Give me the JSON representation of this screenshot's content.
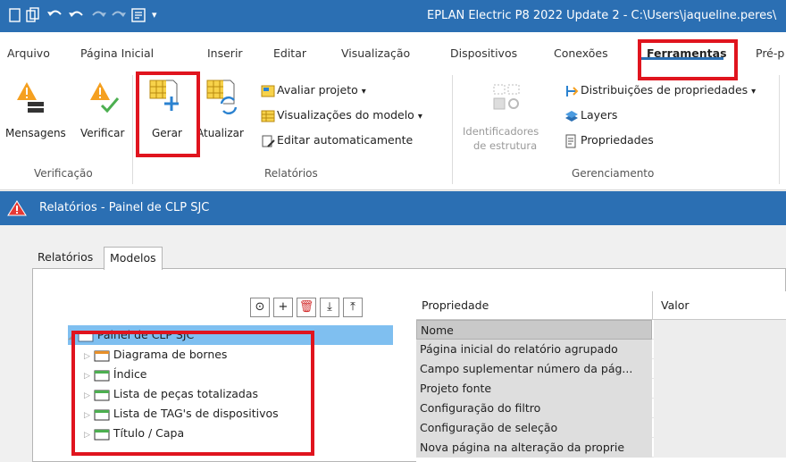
{
  "window": {
    "title": "EPLAN Electric P8 2022 Update 2 - C:\\Users\\jaqueline.peres\\",
    "quick_access_icons": [
      "new-page-icon",
      "copy-page-icon",
      "undo-icon",
      "undo-arrow-icon",
      "redo-icon",
      "redo-arrow-icon",
      "quick-access-menu-icon"
    ],
    "quick_access_chevron": "▾"
  },
  "ribbon_tabs": [
    "Arquivo",
    "Página Inicial",
    "Inserir",
    "Editar",
    "Visualização",
    "Dispositivos",
    "Conexões",
    "Ferramentas",
    "Pré-p"
  ],
  "active_tab": "Ferramentas",
  "groups": {
    "verificacao": {
      "label": "Verificação",
      "mensagens": "Mensagens",
      "verificar": "Verificar"
    },
    "relatorios": {
      "label": "Relatórios",
      "gerar": "Gerar",
      "atualizar": "Atualizar",
      "avaliar_projeto": "Avaliar projeto",
      "visualizacoes_modelo": "Visualizações do modelo",
      "editar_automaticamente": "Editar automaticamente",
      "dropdown_glyph": "▾"
    },
    "gerenciamento": {
      "label": "Gerenciamento",
      "identificadores_line1": "Identificadores",
      "identificadores_line2": "de estrutura",
      "distribuicoes": "Distribuições de propriedades",
      "layers": "Layers",
      "propriedades": "Propriedades",
      "dropdown_glyph": "▾"
    }
  },
  "panel": {
    "title": "Relatórios - Painel de CLP SJC",
    "tabs": [
      "Relatórios",
      "Modelos"
    ],
    "selected_tab": "Modelos"
  },
  "tree_toolbar": {
    "glyphs": [
      "⊙",
      "+",
      "🗑",
      "⤓",
      "⤒"
    ]
  },
  "tree": {
    "root": "Painel de CLP SJC",
    "children": [
      "Diagrama de bornes",
      "Índice",
      "Lista de peças totalizadas",
      "Lista de TAG's de dispositivos",
      "Título / Capa"
    ]
  },
  "property_grid": {
    "columns": [
      "Propriedade",
      "Valor"
    ],
    "rows": [
      "Nome",
      "Página inicial do relatório agrupado",
      "Campo suplementar número da pág...",
      "Projeto fonte",
      "Configuração do filtro",
      "Configuração de seleção",
      "Nova página na alteração da proprie"
    ]
  },
  "colors": {
    "title_bar": "#2b6fb3",
    "highlight_box": "#e0141e",
    "tree_selection": "#7fbff0",
    "folder_green": "#4caf50",
    "folder_orange": "#e8902a"
  }
}
